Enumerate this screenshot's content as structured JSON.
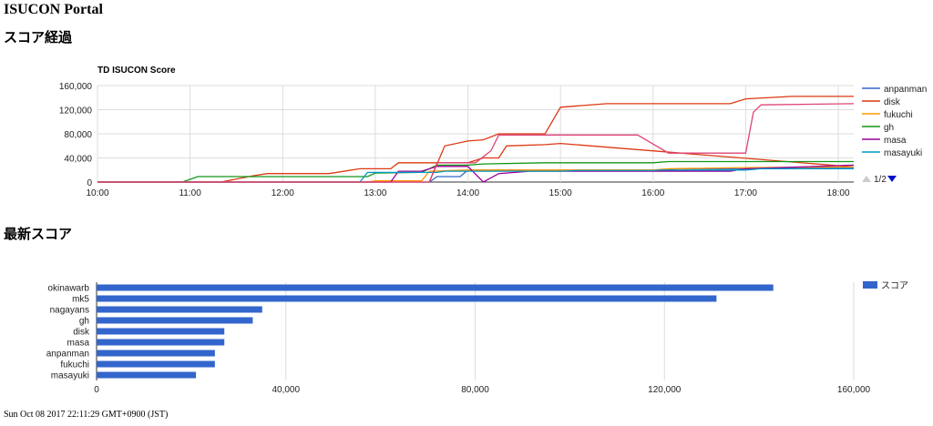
{
  "page": {
    "title": "ISUCON Portal",
    "section_progress": "スコア経過",
    "section_latest": "最新スコア",
    "footer": "Sun Oct 08 2017 22:11:29 GMT+0900 (JST)"
  },
  "chart_data": [
    {
      "type": "line",
      "title": "TD ISUCON Score",
      "xlim": [
        "10:00",
        "18:10"
      ],
      "xticks": [
        "10:00",
        "11:00",
        "12:00",
        "13:00",
        "14:00",
        "15:00",
        "16:00",
        "17:00",
        "18:00"
      ],
      "ylim": [
        0,
        160000
      ],
      "yticks": [
        "0",
        "40,000",
        "80,000",
        "120,000",
        "160,000"
      ],
      "grid": true,
      "legend_position": "right",
      "pager": "1/2",
      "series": [
        {
          "name": "anpanman",
          "color": "#3366cc",
          "points": [
            [
              "10:00",
              0
            ],
            [
              "13:35",
              0
            ],
            [
              "13:40",
              9000
            ],
            [
              "13:55",
              9000
            ],
            [
              "14:00",
              20000
            ],
            [
              "15:00",
              20000
            ],
            [
              "16:10",
              20000
            ],
            [
              "16:15",
              22000
            ],
            [
              "17:00",
              22000
            ],
            [
              "18:10",
              24000
            ]
          ]
        },
        {
          "name": "disk",
          "color": "#dc3912",
          "points": [
            [
              "10:00",
              0
            ],
            [
              "11:20",
              0
            ],
            [
              "11:40",
              10000
            ],
            [
              "11:50",
              14000
            ],
            [
              "12:30",
              14000
            ],
            [
              "12:50",
              22000
            ],
            [
              "13:10",
              22000
            ],
            [
              "13:15",
              32000
            ],
            [
              "14:00",
              32000
            ],
            [
              "14:10",
              40000
            ],
            [
              "14:20",
              40000
            ],
            [
              "14:25",
              60000
            ],
            [
              "14:50",
              62000
            ],
            [
              "15:00",
              64000
            ],
            [
              "18:10",
              25000
            ]
          ]
        },
        {
          "name": "fukuchi",
          "color": "#ff9900",
          "points": [
            [
              "10:00",
              0
            ],
            [
              "12:55",
              0
            ],
            [
              "13:00",
              2000
            ],
            [
              "13:30",
              2000
            ],
            [
              "13:35",
              18000
            ],
            [
              "14:00",
              20000
            ],
            [
              "16:00",
              20000
            ],
            [
              "16:10",
              22000
            ],
            [
              "17:00",
              24000
            ],
            [
              "18:10",
              25000
            ]
          ]
        },
        {
          "name": "gh",
          "color": "#109618",
          "points": [
            [
              "10:00",
              0
            ],
            [
              "10:55",
              0
            ],
            [
              "11:05",
              9000
            ],
            [
              "12:55",
              9000
            ],
            [
              "13:00",
              15000
            ],
            [
              "13:30",
              16000
            ],
            [
              "13:40",
              28000
            ],
            [
              "14:00",
              28000
            ],
            [
              "14:10",
              30000
            ],
            [
              "14:50",
              32000
            ],
            [
              "16:00",
              32000
            ],
            [
              "16:10",
              34000
            ],
            [
              "18:10",
              34000
            ]
          ]
        },
        {
          "name": "masa",
          "color": "#990099",
          "points": [
            [
              "10:00",
              0
            ],
            [
              "13:10",
              0
            ],
            [
              "13:15",
              18000
            ],
            [
              "13:30",
              18000
            ],
            [
              "13:40",
              26000
            ],
            [
              "14:00",
              26000
            ],
            [
              "14:10",
              0
            ],
            [
              "14:20",
              14000
            ],
            [
              "14:40",
              18000
            ],
            [
              "16:50",
              18000
            ],
            [
              "17:00",
              22000
            ],
            [
              "18:10",
              28000
            ]
          ]
        },
        {
          "name": "masayuki",
          "color": "#0099c6",
          "points": [
            [
              "10:00",
              0
            ],
            [
              "12:50",
              0
            ],
            [
              "12:55",
              16000
            ],
            [
              "13:40",
              16000
            ],
            [
              "13:45",
              18000
            ],
            [
              "15:00",
              18000
            ],
            [
              "15:10",
              19000
            ],
            [
              "16:00",
              19000
            ],
            [
              "16:05",
              20000
            ],
            [
              "17:00",
              20000
            ],
            [
              "17:10",
              22000
            ],
            [
              "18:10",
              22000
            ]
          ]
        },
        {
          "name": "",
          "color": "#dc3912",
          "points": [
            [
              "10:00",
              0
            ],
            [
              "13:35",
              0
            ],
            [
              "13:40",
              30000
            ],
            [
              "13:45",
              60000
            ],
            [
              "14:00",
              68000
            ],
            [
              "14:10",
              70000
            ],
            [
              "14:20",
              80000
            ],
            [
              "14:50",
              80000
            ],
            [
              "15:00",
              124000
            ],
            [
              "15:30",
              130000
            ],
            [
              "16:50",
              130000
            ],
            [
              "17:00",
              138000
            ],
            [
              "17:30",
              142000
            ],
            [
              "18:10",
              142000
            ]
          ]
        },
        {
          "name": "",
          "color": "#dd4477",
          "points": [
            [
              "10:00",
              0
            ],
            [
              "13:35",
              0
            ],
            [
              "13:40",
              32000
            ],
            [
              "14:05",
              32000
            ],
            [
              "14:15",
              52000
            ],
            [
              "14:20",
              78000
            ],
            [
              "15:50",
              78000
            ],
            [
              "16:10",
              48000
            ],
            [
              "17:00",
              48000
            ],
            [
              "17:05",
              116000
            ],
            [
              "17:10",
              128000
            ],
            [
              "18:10",
              130000
            ]
          ]
        }
      ]
    },
    {
      "type": "bar",
      "orientation": "horizontal",
      "categories": [
        "okinawarb",
        "mk5",
        "nagayans",
        "gh",
        "disk",
        "masa",
        "anpanman",
        "fukuchi",
        "masayuki"
      ],
      "series": [
        {
          "name": "スコア",
          "color": "#3366cc",
          "values": [
            143000,
            131000,
            35000,
            33000,
            27000,
            27000,
            25000,
            25000,
            21000
          ]
        }
      ],
      "xlim": [
        0,
        160000
      ],
      "xticks": [
        "0",
        "40,000",
        "80,000",
        "120,000",
        "160,000"
      ],
      "grid": true,
      "legend_position": "right"
    }
  ]
}
